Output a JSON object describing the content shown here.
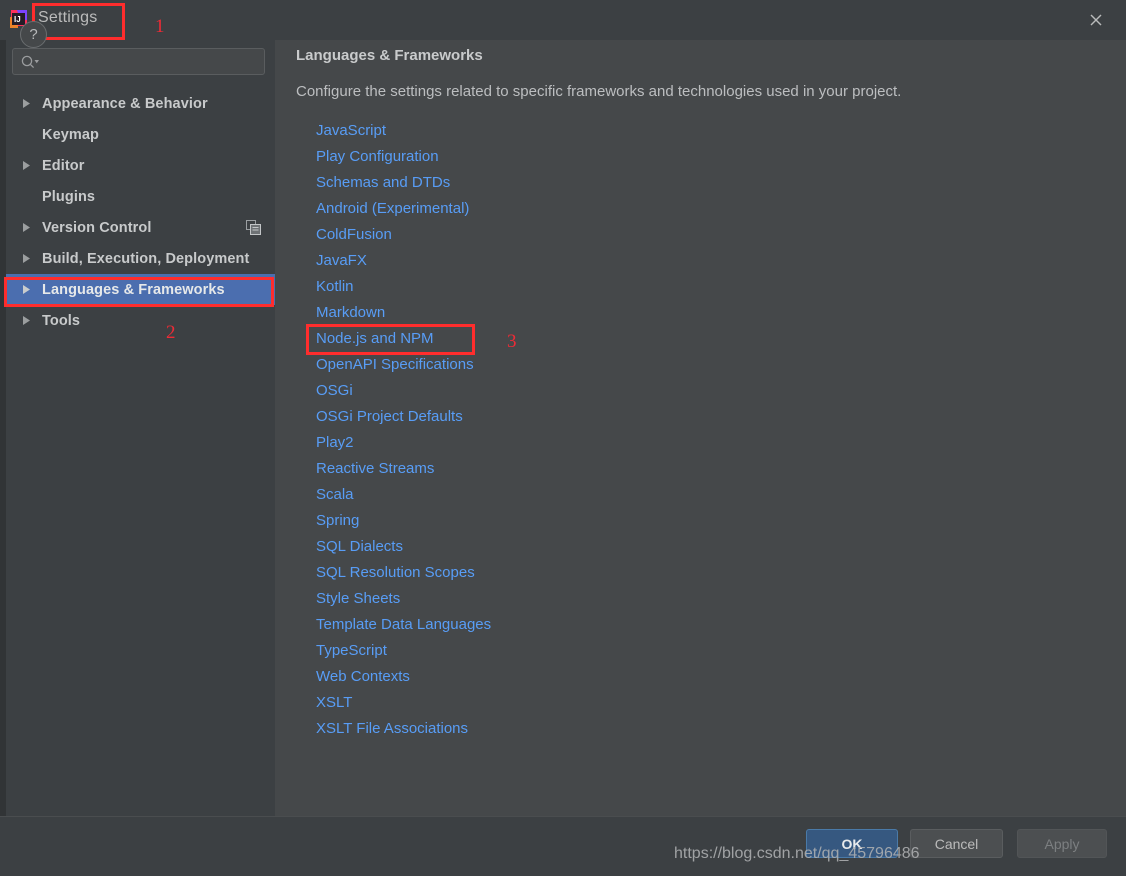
{
  "window": {
    "title": "Settings",
    "logo_icon": "intellij-idea-logo",
    "close_icon": "close-icon"
  },
  "search": {
    "value": "",
    "placeholder": "",
    "icon": "search-icon",
    "dropdown_icon": "chevron-down-icon"
  },
  "sidebar": {
    "items": [
      {
        "label": "Appearance & Behavior",
        "expandable": true,
        "selected": false,
        "trailing_icon": ""
      },
      {
        "label": "Keymap",
        "expandable": false,
        "selected": false,
        "trailing_icon": ""
      },
      {
        "label": "Editor",
        "expandable": true,
        "selected": false,
        "trailing_icon": ""
      },
      {
        "label": "Plugins",
        "expandable": false,
        "selected": false,
        "trailing_icon": ""
      },
      {
        "label": "Version Control",
        "expandable": true,
        "selected": false,
        "trailing_icon": "copy-icon"
      },
      {
        "label": "Build, Execution, Deployment",
        "expandable": true,
        "selected": false,
        "trailing_icon": ""
      },
      {
        "label": "Languages & Frameworks",
        "expandable": true,
        "selected": true,
        "trailing_icon": ""
      },
      {
        "label": "Tools",
        "expandable": true,
        "selected": false,
        "trailing_icon": ""
      }
    ]
  },
  "content": {
    "title": "Languages & Frameworks",
    "description": "Configure the settings related to specific frameworks and technologies used in your project.",
    "links": [
      "JavaScript",
      "Play Configuration",
      "Schemas and DTDs",
      "Android (Experimental)",
      "ColdFusion",
      "JavaFX",
      "Kotlin",
      "Markdown",
      "Node.js and NPM",
      "OpenAPI Specifications",
      "OSGi",
      "OSGi Project Defaults",
      "Play2",
      "Reactive Streams",
      "Scala",
      "Spring",
      "SQL Dialects",
      "SQL Resolution Scopes",
      "Style Sheets",
      "Template Data Languages",
      "TypeScript",
      "Web Contexts",
      "XSLT",
      "XSLT File Associations"
    ]
  },
  "footer": {
    "help_label": "?",
    "ok_label": "OK",
    "cancel_label": "Cancel",
    "apply_label": "Apply"
  },
  "watermark": "https://blog.csdn.net/qq_45796486",
  "annotations": {
    "numbers": [
      "1",
      "2",
      "3"
    ],
    "color": "#ee2b36",
    "targets": [
      "settings-title",
      "languages-and-frameworks-sidebar-item",
      "node-js-and-npm-link"
    ]
  },
  "colors": {
    "sidebar_bg": "#3c4043",
    "content_bg": "#45484a",
    "selection": "#4b6eaf",
    "link": "#589df6",
    "ok_button": "#365880",
    "annotation_red": "#ff2d2d"
  }
}
